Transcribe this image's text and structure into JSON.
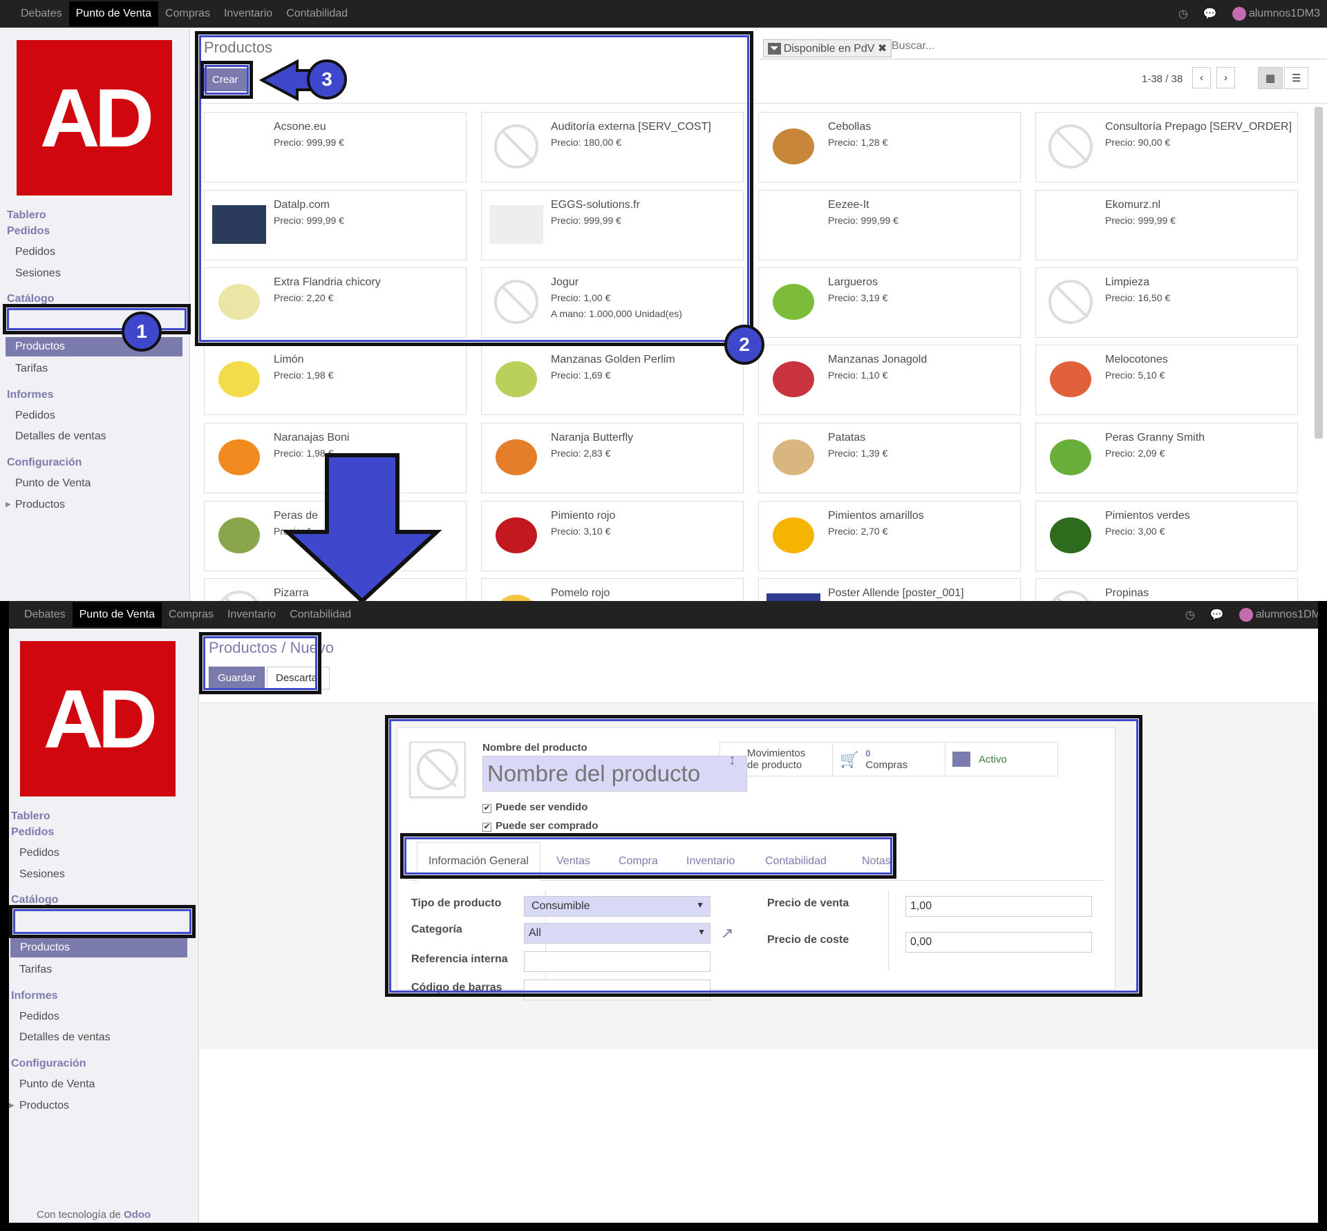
{
  "topbar": {
    "menu": [
      "Debates",
      "Punto de Venta",
      "Compras",
      "Inventario",
      "Contabilidad"
    ],
    "user": "alumnos1DM3",
    "user_short": "alumnos1DM"
  },
  "logo": {
    "text": "AD",
    "color": "#d0070f"
  },
  "sidebar": {
    "tablero": "Tablero",
    "pedidos_header": "Pedidos",
    "pedidos": "Pedidos",
    "sesiones": "Sesiones",
    "catalogo": "Catálogo",
    "productos": "Productos",
    "tarifas": "Tarifas",
    "informes": "Informes",
    "inf_pedidos": "Pedidos",
    "detalles": "Detalles de ventas",
    "configuracion": "Configuración",
    "punto_venta": "Punto de Venta",
    "conf_productos": "Productos",
    "footer_prefix": "Con tecnología de",
    "footer_brand": "Odoo"
  },
  "list_view": {
    "title": "Productos",
    "create_label": "Crear",
    "filter_label": "Disponible en PdV",
    "search_placeholder": "Buscar...",
    "pager": "1-38 / 38"
  },
  "products": [
    {
      "name": "Acsone.eu",
      "price": "Precio: 999,99 €",
      "img": "acsone"
    },
    {
      "name": "Auditoría externa [SERV_COST]",
      "price": "Precio: 180,00 €",
      "img": "none"
    },
    {
      "name": "Cebollas",
      "price": "Precio: 1,28 €",
      "img": "onion"
    },
    {
      "name": "Consultoría Prepago [SERV_ORDER]",
      "price": "Precio: 90,00 €",
      "img": "none"
    },
    {
      "name": "Datalp.com",
      "price": "Precio: 999,99 €",
      "img": "datalp"
    },
    {
      "name": "EGGS-solutions.fr",
      "price": "Precio: 999,99 €",
      "img": "eggs"
    },
    {
      "name": "Eezee-It",
      "price": "Precio: 999,99 €",
      "img": "eezee"
    },
    {
      "name": "Ekomurz.nl",
      "price": "Precio: 999,99 €",
      "img": "ekomurz"
    },
    {
      "name": "Extra Flandria chicory",
      "price": "Precio: 2,20 €",
      "img": "chicory"
    },
    {
      "name": "Jogur",
      "price": "Precio: 1,00 €",
      "stock": "A mano: 1.000,000 Unidad(es)",
      "img": "none"
    },
    {
      "name": "Largueros",
      "price": "Precio: 3,19 €",
      "img": "lime"
    },
    {
      "name": "Limpieza",
      "price": "Precio: 16,50 €",
      "img": "none"
    },
    {
      "name": "Limón",
      "price": "Precio: 1,98 €",
      "img": "lemon"
    },
    {
      "name": "Manzanas Golden Perlim",
      "price": "Precio: 1,69 €",
      "img": "golden"
    },
    {
      "name": "Manzanas Jonagold",
      "price": "Precio: 1,10 €",
      "img": "jonagold"
    },
    {
      "name": "Melocotones",
      "price": "Precio: 5,10 €",
      "img": "peach"
    },
    {
      "name": "Naranajas Boni",
      "price": "Precio: 1,98 €",
      "img": "orange"
    },
    {
      "name": "Naranja Butterfly",
      "price": "Precio: 2,83 €",
      "img": "butterfly"
    },
    {
      "name": "Patatas",
      "price": "Precio: 1,39 €",
      "img": "potato"
    },
    {
      "name": "Peras Granny Smith",
      "price": "Precio: 2,09 €",
      "img": "granny"
    },
    {
      "name": "Peras de",
      "price": "Precio: 1,",
      "img": "pear"
    },
    {
      "name": "Pimiento rojo",
      "price": "Precio: 3,10 €",
      "img": "redpepper"
    },
    {
      "name": "Pimientos amarillos",
      "price": "Precio: 2,70 €",
      "img": "yellowpepper"
    },
    {
      "name": "Pimientos verdes",
      "price": "Precio: 3,00 €",
      "img": "greenpepper"
    },
    {
      "name": "Pizarra",
      "price": "",
      "img": "none"
    },
    {
      "name": "Pomelo rojo",
      "price": "",
      "img": "grapefruit"
    },
    {
      "name": "Poster Allende [poster_001]",
      "price": "",
      "img": "poster"
    },
    {
      "name": "Propinas",
      "price": "",
      "img": "none"
    }
  ],
  "callouts": {
    "one": "1",
    "two": "2",
    "three": "3"
  },
  "form_view": {
    "breadcrumb_parent": "Productos",
    "breadcrumb_sep": "/",
    "breadcrumb_current": "Nuevo",
    "save_label": "Guardar",
    "discard_label": "Descartar",
    "name_label": "Nombre del producto",
    "name_placeholder": "Nombre del producto",
    "can_sell": "Puede ser vendido",
    "can_buy": "Puede ser comprado",
    "smart_moves_line1": "Movimientos",
    "smart_moves_line2": "de producto",
    "smart_purchases_count": "0",
    "smart_purchases_label": "Compras",
    "smart_active": "Activo",
    "tabs": [
      "Información General",
      "Ventas",
      "Compra",
      "Inventario",
      "Contabilidad",
      "Notas"
    ],
    "tipo_label": "Tipo de producto",
    "tipo_value": "Consumible",
    "categoria_label": "Categoría",
    "categoria_value": "All",
    "ref_label": "Referencia interna",
    "barcode_label": "Código de barras",
    "precio_venta_label": "Precio de venta",
    "precio_venta_value": "1,00",
    "precio_coste_label": "Precio de coste",
    "precio_coste_value": "0,00"
  },
  "colors": {
    "accent": "#7c7bad",
    "callout": "#3f48cc",
    "topbar": "#222222"
  }
}
